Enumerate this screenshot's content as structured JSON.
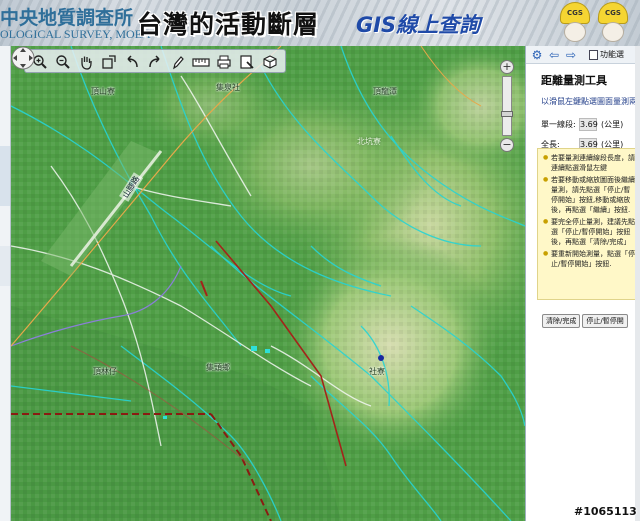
{
  "header": {
    "org_cn": "中央地質調查所",
    "org_en": "OLOGICAL SURVEY, MOEA",
    "site_title": "台灣的活動斷層",
    "site_subtitle": "GIS線上查詢",
    "mascot_helmet_1": "CGS",
    "mascot_helmet_2": "CGS"
  },
  "map": {
    "labels": {
      "top_left": "頂山寮",
      "top_center": "集泉社",
      "top_right": "頂龍潭",
      "center_top": "北坑寮",
      "bottom_left": "頂林仔",
      "bottom_center": "集頭鄉",
      "bottom_right": "社寮",
      "road": "山腳路"
    },
    "toolbar_icons": [
      "zoom-in",
      "zoom-out",
      "pan",
      "zoom-box",
      "back",
      "forward",
      "measure",
      "identify",
      "print",
      "query",
      "select"
    ]
  },
  "panel": {
    "func_button": "功能選",
    "title": "距離量測工具",
    "hint": "以滑鼠左鍵點選圖面量測兩點",
    "segment_label": "單一線段:",
    "segment_value": "3.69",
    "segment_unit": "(公里)",
    "total_label": "全長:",
    "total_value": "3.69",
    "total_unit": "(公里)",
    "help_items": [
      "若要量測連續線段長度，請連續點選滑鼠左鍵",
      "若要移動或縮放圖面後繼續量測，請先點選「停止/暫停開始」按鈕,移動或縮放後，再點選「繼續」按鈕.",
      "要完全停止量測，建議先點選「停止/暫停開始」按鈕後，再點選「清除/完成」",
      "要重新開始測量，點選「停止/暫停開始」按鈕."
    ],
    "clear_button": "清除/完成",
    "stop_button": "停止/暫停開"
  },
  "watermark": "#1065113"
}
